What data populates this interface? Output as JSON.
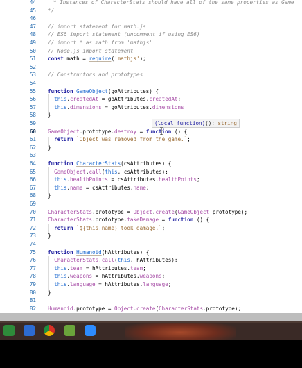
{
  "editor": {
    "lines": [
      {
        "n": "44",
        "tokens": [
          {
            "t": "* Instances of CharacterStats should have all of the same properties as Game",
            "c": "cm"
          }
        ]
      },
      {
        "n": "45",
        "tokens": [
          {
            "t": "*/",
            "c": "cm"
          }
        ]
      },
      {
        "n": "46",
        "tokens": []
      },
      {
        "n": "47",
        "tokens": [
          {
            "t": "// import statement for math.js",
            "c": "cm"
          }
        ]
      },
      {
        "n": "48",
        "tokens": [
          {
            "t": "// ES6 import statement (uncomment if using ES6)",
            "c": "cm"
          }
        ]
      },
      {
        "n": "49",
        "tokens": [
          {
            "t": "// import * as math from 'mathjs'",
            "c": "cm"
          }
        ]
      },
      {
        "n": "50",
        "tokens": [
          {
            "t": "// Node.js import statement",
            "c": "cm"
          }
        ]
      },
      {
        "n": "51",
        "tokens": [
          {
            "t": "const",
            "c": "kw"
          },
          {
            "t": " math = "
          },
          {
            "t": "require",
            "c": "fn"
          },
          {
            "t": "("
          },
          {
            "t": "'mathjs'",
            "c": "str"
          },
          {
            "t": ");"
          }
        ]
      },
      {
        "n": "52",
        "tokens": []
      },
      {
        "n": "53",
        "tokens": [
          {
            "t": "// Constructors and prototypes",
            "c": "cm"
          }
        ]
      },
      {
        "n": "54",
        "tokens": []
      },
      {
        "n": "55",
        "tokens": [
          {
            "t": "function",
            "c": "kw"
          },
          {
            "t": " "
          },
          {
            "t": "GameObject",
            "c": "fn"
          },
          {
            "t": "(goAttributes) {"
          }
        ]
      },
      {
        "n": "56",
        "tokens": [
          {
            "t": "  "
          },
          {
            "t": "this",
            "c": "th"
          },
          {
            "t": "."
          },
          {
            "t": "createdAt",
            "c": "pr"
          },
          {
            "t": " = goAttributes."
          },
          {
            "t": "createdAt",
            "c": "pr"
          },
          {
            "t": ";"
          }
        ]
      },
      {
        "n": "57",
        "tokens": [
          {
            "t": "  "
          },
          {
            "t": "this",
            "c": "th"
          },
          {
            "t": "."
          },
          {
            "t": "dimensions",
            "c": "pr"
          },
          {
            "t": " = goAttributes."
          },
          {
            "t": "dimensions",
            "c": "pr"
          }
        ]
      },
      {
        "n": "58",
        "tokens": [
          {
            "t": "}"
          }
        ]
      },
      {
        "n": "59",
        "tokens": []
      },
      {
        "n": "60",
        "active": true,
        "tokens": [
          {
            "t": "GameObject",
            "c": "pr"
          },
          {
            "t": ".prototype."
          },
          {
            "t": "destroy",
            "c": "pr"
          },
          {
            "t": " = "
          },
          {
            "t": "function",
            "c": "kw"
          },
          {
            "t": " () {"
          }
        ]
      },
      {
        "n": "61",
        "tokens": [
          {
            "t": "  "
          },
          {
            "t": "return",
            "c": "kw"
          },
          {
            "t": " "
          },
          {
            "t": "`Object was removed from the game.`",
            "c": "str"
          },
          {
            "t": ";"
          }
        ]
      },
      {
        "n": "62",
        "tokens": [
          {
            "t": "}"
          }
        ]
      },
      {
        "n": "63",
        "tokens": []
      },
      {
        "n": "64",
        "tokens": [
          {
            "t": "function",
            "c": "kw"
          },
          {
            "t": " "
          },
          {
            "t": "CharacterStats",
            "c": "fn"
          },
          {
            "t": "(csAttributes) {"
          }
        ]
      },
      {
        "n": "65",
        "tokens": [
          {
            "t": "  "
          },
          {
            "t": "GameObject",
            "c": "pr"
          },
          {
            "t": "."
          },
          {
            "t": "call",
            "c": "pr"
          },
          {
            "t": "("
          },
          {
            "t": "this",
            "c": "th"
          },
          {
            "t": ", csAttributes);"
          }
        ]
      },
      {
        "n": "66",
        "tokens": [
          {
            "t": "  "
          },
          {
            "t": "this",
            "c": "th"
          },
          {
            "t": "."
          },
          {
            "t": "healthPoints",
            "c": "pr"
          },
          {
            "t": " = csAttributes."
          },
          {
            "t": "healthPoints",
            "c": "pr"
          },
          {
            "t": ";"
          }
        ]
      },
      {
        "n": "67",
        "tokens": [
          {
            "t": "  "
          },
          {
            "t": "this",
            "c": "th"
          },
          {
            "t": "."
          },
          {
            "t": "name",
            "c": "pr"
          },
          {
            "t": " = csAttributes."
          },
          {
            "t": "name",
            "c": "pr"
          },
          {
            "t": ";"
          }
        ]
      },
      {
        "n": "68",
        "tokens": [
          {
            "t": "}"
          }
        ]
      },
      {
        "n": "69",
        "tokens": []
      },
      {
        "n": "70",
        "tokens": [
          {
            "t": "CharacterStats",
            "c": "pr"
          },
          {
            "t": ".prototype = "
          },
          {
            "t": "Object",
            "c": "pr"
          },
          {
            "t": "."
          },
          {
            "t": "create",
            "c": "pr"
          },
          {
            "t": "("
          },
          {
            "t": "GameObject",
            "c": "pr"
          },
          {
            "t": ".prototype);"
          }
        ]
      },
      {
        "n": "71",
        "tokens": [
          {
            "t": "CharacterStats",
            "c": "pr"
          },
          {
            "t": ".prototype."
          },
          {
            "t": "takeDamage",
            "c": "pr"
          },
          {
            "t": " = "
          },
          {
            "t": "function",
            "c": "kw"
          },
          {
            "t": " () {"
          }
        ]
      },
      {
        "n": "72",
        "tokens": [
          {
            "t": "  "
          },
          {
            "t": "return",
            "c": "kw"
          },
          {
            "t": " "
          },
          {
            "t": "`${this.name} took damage.`",
            "c": "str"
          },
          {
            "t": ";"
          }
        ]
      },
      {
        "n": "73",
        "tokens": [
          {
            "t": "}"
          }
        ]
      },
      {
        "n": "74",
        "tokens": []
      },
      {
        "n": "75",
        "tokens": [
          {
            "t": "function",
            "c": "kw"
          },
          {
            "t": " "
          },
          {
            "t": "Humanoid",
            "c": "fn"
          },
          {
            "t": "(hAttributes) {"
          }
        ]
      },
      {
        "n": "76",
        "tokens": [
          {
            "t": "  "
          },
          {
            "t": "CharacterStats",
            "c": "pr"
          },
          {
            "t": "."
          },
          {
            "t": "call",
            "c": "pr"
          },
          {
            "t": "("
          },
          {
            "t": "this",
            "c": "th"
          },
          {
            "t": ", hAttributes);"
          }
        ]
      },
      {
        "n": "77",
        "tokens": [
          {
            "t": "  "
          },
          {
            "t": "this",
            "c": "th"
          },
          {
            "t": "."
          },
          {
            "t": "team",
            "c": "pr"
          },
          {
            "t": " = hAttributes."
          },
          {
            "t": "team",
            "c": "pr"
          },
          {
            "t": ";"
          }
        ]
      },
      {
        "n": "78",
        "tokens": [
          {
            "t": "  "
          },
          {
            "t": "this",
            "c": "th"
          },
          {
            "t": "."
          },
          {
            "t": "weapons",
            "c": "pr"
          },
          {
            "t": " = hAttributes."
          },
          {
            "t": "weapons",
            "c": "pr"
          },
          {
            "t": ";"
          }
        ]
      },
      {
        "n": "79",
        "tokens": [
          {
            "t": "  "
          },
          {
            "t": "this",
            "c": "th"
          },
          {
            "t": "."
          },
          {
            "t": "language",
            "c": "pr"
          },
          {
            "t": " = hAttributes."
          },
          {
            "t": "language",
            "c": "pr"
          },
          {
            "t": ";"
          }
        ]
      },
      {
        "n": "80",
        "tokens": [
          {
            "t": "}"
          }
        ]
      },
      {
        "n": "81",
        "tokens": []
      },
      {
        "n": "82",
        "tokens": [
          {
            "t": "Humanoid",
            "c": "pr"
          },
          {
            "t": ".prototype = "
          },
          {
            "t": "Object",
            "c": "pr"
          },
          {
            "t": "."
          },
          {
            "t": "create",
            "c": "pr"
          },
          {
            "t": "("
          },
          {
            "t": "CharacterStats",
            "c": "pr"
          },
          {
            "t": ".prototype);"
          }
        ]
      }
    ]
  },
  "tooltip": {
    "open_paren": "(",
    "kind": "local function",
    "close_paren": ")",
    "signature": "(): ",
    "return_type": "string"
  },
  "taskbar": {
    "icons": [
      {
        "name": "code-editor-icon",
        "color": "#2e8b3a"
      },
      {
        "name": "visual-studio-icon",
        "color": "#2d6bd1"
      },
      {
        "name": "chrome-icon",
        "color": "#e0b32a"
      },
      {
        "name": "notes-app-icon",
        "color": "#6aa43b"
      },
      {
        "name": "zoom-icon",
        "color": "#2d8cff"
      }
    ]
  }
}
